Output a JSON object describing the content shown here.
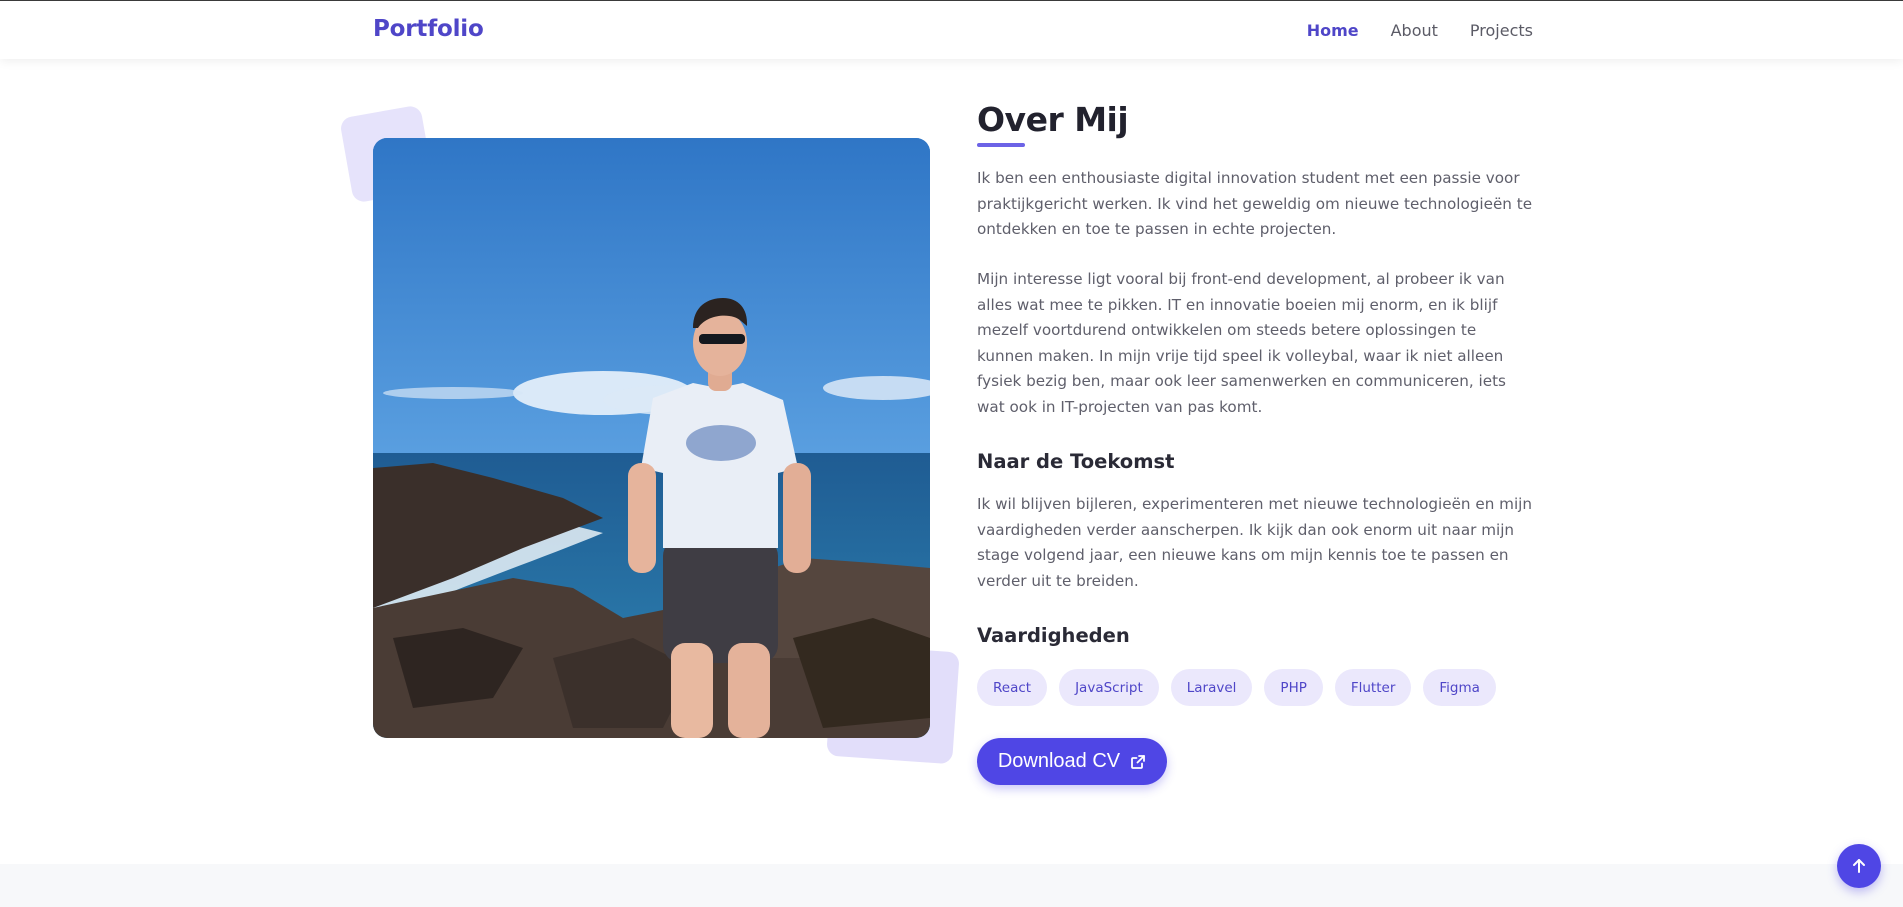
{
  "header": {
    "brand": "Portfolio",
    "nav": [
      {
        "label": "Home",
        "active": true
      },
      {
        "label": "About",
        "active": false
      },
      {
        "label": "Projects",
        "active": false
      }
    ]
  },
  "about": {
    "photo_alt": "Portretfoto",
    "title": "Over Mij",
    "intro": "Ik ben een enthousiaste digital innovation student met een passie voor praktijkgericht werken. Ik vind het geweldig om nieuwe technologieën te ontdekken en toe te passen in echte projecten.",
    "interest": "Mijn interesse ligt vooral bij front-end development, al probeer ik van alles wat mee te pikken. IT en innovatie boeien mij enorm, en ik blijf mezelf voortdurend ontwikkelen om steeds betere oplossingen te kunnen maken. In mijn vrije tijd speel ik volleybal, waar ik niet alleen fysiek bezig ben, maar ook leer samenwerken en communiceren, iets wat ook in IT-projecten van pas komt.",
    "future_heading": "Naar de Toekomst",
    "future_text": "Ik wil blijven bijleren, experimenteren met nieuwe technologieën en mijn vaardigheden verder aanscherpen. Ik kijk dan ook enorm uit naar mijn stage volgend jaar, een nieuwe kans om mijn kennis toe te passen en verder uit te breiden.",
    "skills_heading": "Vaardigheden",
    "skills": [
      "React",
      "JavaScript",
      "Laravel",
      "PHP",
      "Flutter",
      "Figma"
    ],
    "cv_label": "Download CV"
  },
  "colors": {
    "accent": "#4f46e5",
    "brand": "#4f46c8",
    "chip_bg": "#ebe8fc"
  },
  "icons": {
    "cv": "external-link-icon",
    "scroll_top": "arrow-up-icon"
  }
}
